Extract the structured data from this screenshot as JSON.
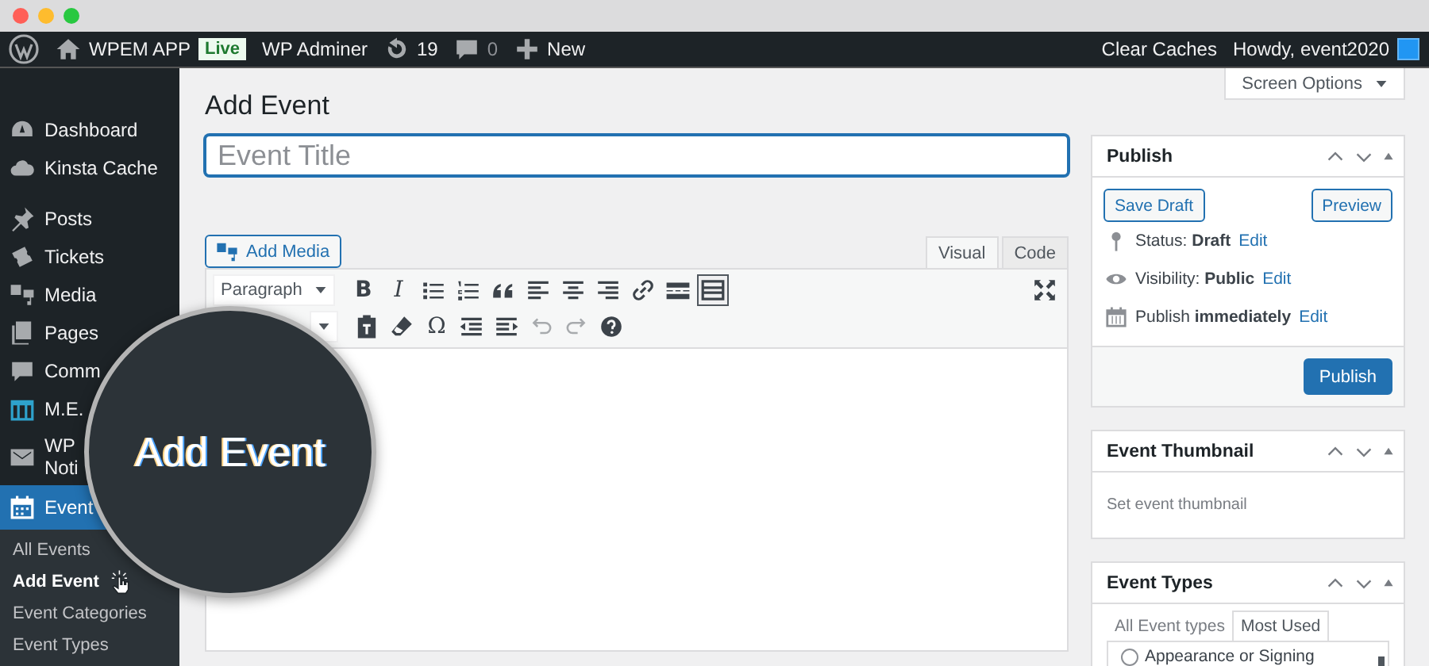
{
  "window": {
    "controls": [
      {
        "color": "#ff5f57"
      },
      {
        "color": "#febc2e"
      },
      {
        "color": "#28c840"
      }
    ]
  },
  "admin_bar": {
    "left": [
      {
        "kind": "logo"
      },
      {
        "kind": "home",
        "label": "WPEM APP"
      },
      {
        "kind": "badge",
        "label": "Live"
      },
      {
        "kind": "text",
        "label": "WP Adminer"
      },
      {
        "kind": "updates",
        "label": "19"
      },
      {
        "kind": "comments",
        "label": "0"
      },
      {
        "kind": "new",
        "label": "New"
      }
    ],
    "right": [
      {
        "kind": "text",
        "label": "Clear Caches"
      },
      {
        "kind": "user",
        "label": "Howdy, event2020"
      }
    ]
  },
  "sidebar": {
    "groups": [
      [
        {
          "kind": "dashboard",
          "label": "Dashboard",
          "selected": false
        },
        {
          "kind": "cloud",
          "label": "Kinsta Cache",
          "selected": false
        }
      ],
      [
        {
          "kind": "pin",
          "label": "Posts",
          "selected": false
        },
        {
          "kind": "tickets",
          "label": "Tickets",
          "selected": false
        },
        {
          "kind": "media",
          "label": "Media",
          "selected": false
        },
        {
          "kind": "pages",
          "label": "Pages",
          "selected": false
        },
        {
          "kind": "comments",
          "label": "Comm",
          "selected": false
        },
        {
          "kind": "grid",
          "label": "M.E.",
          "selected": false
        },
        {
          "kind": "mail",
          "label": "WP\nNoti",
          "selected": false
        },
        {
          "kind": "calendar",
          "label": "Event",
          "selected": true,
          "children": [
            {
              "label": "All Events",
              "selected": false
            },
            {
              "label": "Add Event",
              "selected": true
            },
            {
              "label": "Event Categories",
              "selected": false
            },
            {
              "label": "Event Types",
              "selected": false
            }
          ]
        }
      ]
    ]
  },
  "callout": {
    "label": "Add Event"
  },
  "screen_options": {
    "label": "Screen Options"
  },
  "page_title": "Add Event",
  "title_field": {
    "placeholder": "Event Title"
  },
  "add_media": {
    "label": "Add Media"
  },
  "editor_tabs": [
    {
      "label": "Visual",
      "selected": true
    },
    {
      "label": "Code",
      "selected": false
    }
  ],
  "toolbar": {
    "rows": [
      [
        {
          "kind": "select",
          "label": "Paragraph"
        },
        {
          "kind": "bold",
          "label": "B"
        },
        {
          "kind": "italic",
          "label": "I"
        },
        {
          "kind": "bullets"
        },
        {
          "kind": "numbers"
        },
        {
          "kind": "quote"
        },
        {
          "kind": "align-left"
        },
        {
          "kind": "align-center"
        },
        {
          "kind": "align-right"
        },
        {
          "kind": "link"
        },
        {
          "kind": "more"
        },
        {
          "kind": "toggle",
          "selected": true
        },
        {
          "kind": "fullscreen"
        }
      ],
      [
        {
          "kind": "select"
        },
        {
          "kind": "paste"
        },
        {
          "kind": "eraser"
        },
        {
          "kind": "symbol",
          "label": "Ω"
        },
        {
          "kind": "outdent"
        },
        {
          "kind": "indent"
        },
        {
          "kind": "undo",
          "disabled": true
        },
        {
          "kind": "redo",
          "disabled": true
        },
        {
          "kind": "help"
        }
      ]
    ]
  },
  "publish_box": {
    "title": "Publish",
    "save_draft": "Save Draft",
    "preview": "Preview",
    "lines": [
      {
        "kind": "status",
        "text": "Status: **Draft**",
        "link": "Edit"
      },
      {
        "kind": "visibility",
        "text": "Visibility: **Public**",
        "link": "Edit"
      },
      {
        "kind": "schedule",
        "text": "Publish **immediately**",
        "link": "Edit"
      }
    ],
    "publish": "Publish"
  },
  "thumbnail_box": {
    "title": "Event Thumbnail",
    "link": "Set event thumbnail"
  },
  "types_box": {
    "title": "Event Types",
    "tabs": [
      {
        "label": "All Event types",
        "selected": false
      },
      {
        "label": "Most Used",
        "selected": true
      }
    ],
    "options": [
      {
        "label": "Appearance or Signing",
        "checked": false
      }
    ]
  }
}
